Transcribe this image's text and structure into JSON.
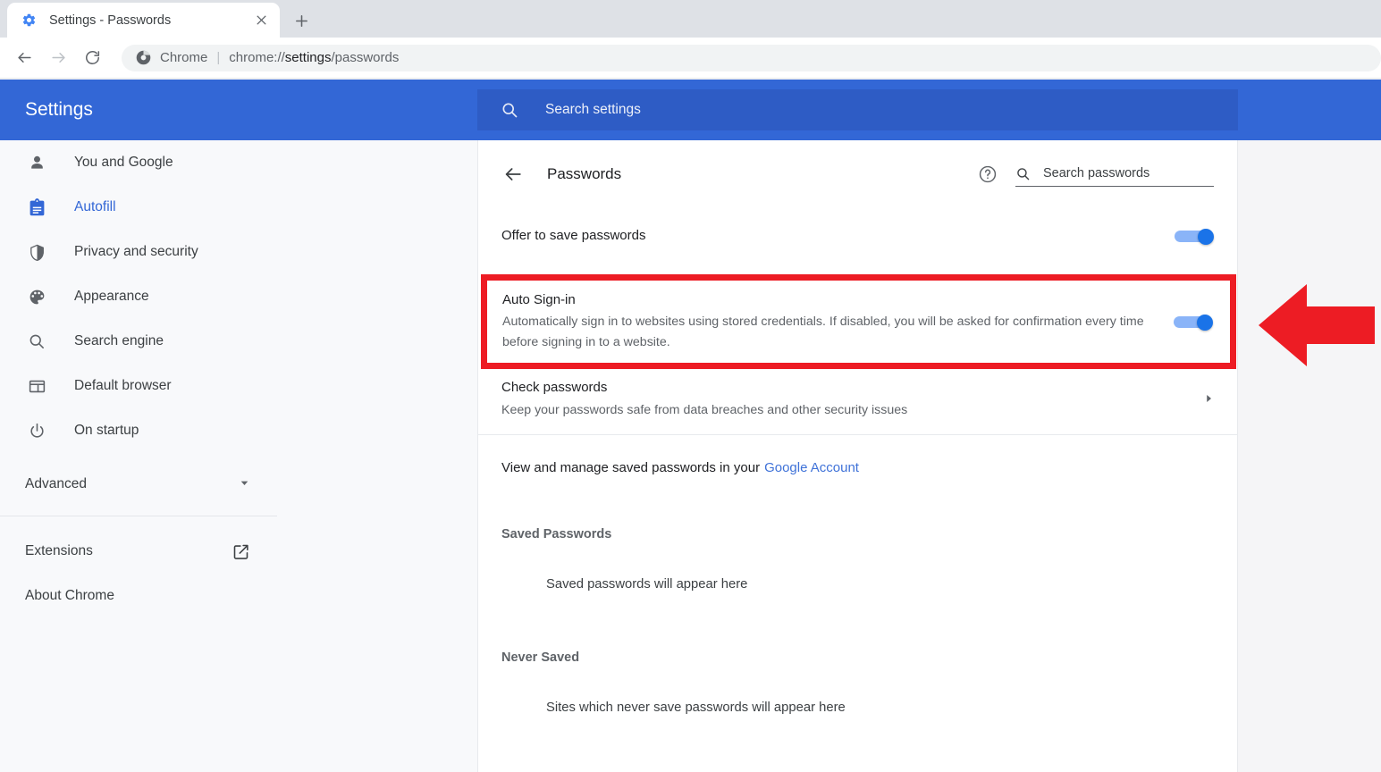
{
  "browser": {
    "tab": {
      "title": "Settings - Passwords",
      "favicon_icon": "gear-icon",
      "close_icon": "close-icon"
    },
    "new_tab_icon": "plus-icon",
    "toolbar": {
      "back_icon": "back-arrow-icon",
      "forward_icon": "forward-arrow-icon",
      "reload_icon": "reload-icon",
      "omnibox": {
        "site_icon": "chrome-logo-icon",
        "scheme_label": "Chrome",
        "separator": "|",
        "url_prefix": "chrome://",
        "url_bold": "settings",
        "url_suffix": "/passwords",
        "full_url": "chrome://settings/passwords"
      }
    }
  },
  "settings_header": {
    "brand": "Settings",
    "search_icon": "search-icon",
    "search_placeholder": "Search settings",
    "background_color": "#3367d6",
    "search_background_color": "#2e5cc5"
  },
  "sidebar": {
    "items": [
      {
        "label": "You and Google",
        "icon": "person-icon",
        "active": false
      },
      {
        "label": "Autofill",
        "icon": "clipboard-icon",
        "active": true
      },
      {
        "label": "Privacy and security",
        "icon": "shield-icon",
        "active": false
      },
      {
        "label": "Appearance",
        "icon": "palette-icon",
        "active": false
      },
      {
        "label": "Search engine",
        "icon": "magnifier-icon",
        "active": false
      },
      {
        "label": "Default browser",
        "icon": "browser-window-icon",
        "active": false
      },
      {
        "label": "On startup",
        "icon": "power-icon",
        "active": false
      }
    ],
    "advanced": {
      "label": "Advanced",
      "caret_icon": "chevron-down-icon"
    },
    "extensions": {
      "label": "Extensions",
      "icon": "external-link-icon"
    },
    "about": {
      "label": "About Chrome"
    },
    "active_color": "#3367d6"
  },
  "main": {
    "back_icon": "back-arrow-icon",
    "title": "Passwords",
    "help_icon": "help-circle-icon",
    "search": {
      "icon": "search-icon",
      "placeholder": "Search passwords"
    },
    "offer_to_save": {
      "label": "Offer to save passwords",
      "toggle_state": "on"
    },
    "auto_signin": {
      "title": "Auto Sign-in",
      "description": "Automatically sign in to websites using stored credentials. If disabled, you will be asked for confirmation every time before signing in to a website.",
      "toggle_state": "on",
      "highlight_color": "#ed1c24"
    },
    "check_passwords": {
      "title": "Check passwords",
      "description": "Keep your passwords safe from data breaches and other security issues",
      "chevron_icon": "chevron-right-icon"
    },
    "manage_link": {
      "text_before": "View and manage saved passwords in your",
      "link_text": "Google Account",
      "link_color": "#3f72d8"
    },
    "saved_passwords": {
      "heading": "Saved Passwords",
      "empty_text": "Saved passwords will appear here"
    },
    "never_saved": {
      "heading": "Never Saved",
      "empty_text": "Sites which never save passwords will appear here"
    }
  },
  "annotation": {
    "arrow_icon": "left-arrow-annotation-icon",
    "arrow_color": "#ed1c24",
    "points_to": "auto-signin-row"
  }
}
